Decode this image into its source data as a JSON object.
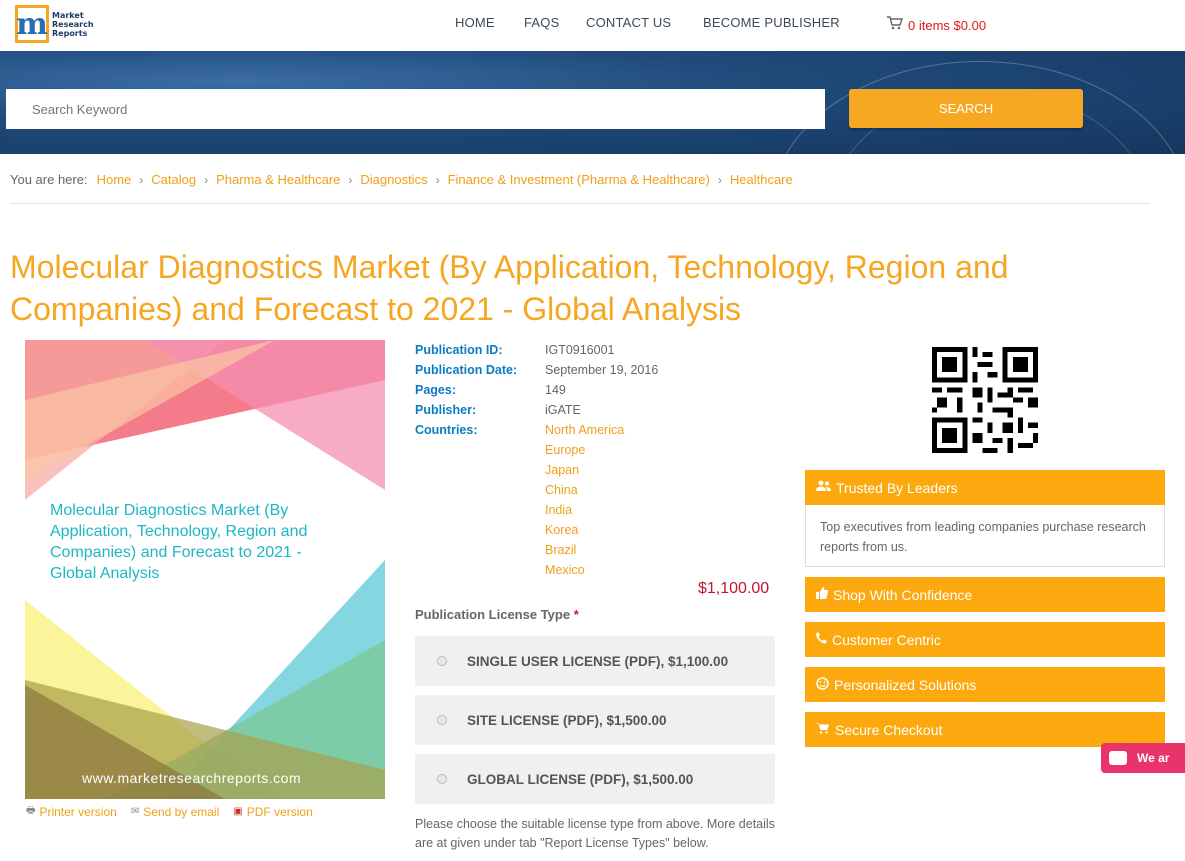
{
  "header": {
    "logo": {
      "line1": "Market",
      "line2": "Research",
      "line3": "Reports"
    },
    "nav": [
      {
        "label": "HOME"
      },
      {
        "label": "FAQS"
      },
      {
        "label": "CONTACT US"
      },
      {
        "label": "BECOME PUBLISHER"
      }
    ],
    "cart": {
      "label": "0 items $0.00"
    }
  },
  "search": {
    "placeholder": "Search Keyword",
    "button": "SEARCH"
  },
  "breadcrumb": {
    "prefix": "You are here:",
    "items": [
      "Home",
      "Catalog",
      "Pharma & Healthcare",
      "Diagnostics",
      "Finance & Investment (Pharma & Healthcare)",
      "Healthcare"
    ]
  },
  "report": {
    "title": "Molecular Diagnostics Market (By Application, Technology, Region and Companies) and Forecast to 2021 - Global Analysis",
    "cover_title": "Molecular Diagnostics Market (By Application, Technology, Region and Companies) and Forecast to 2021 - Global Analysis",
    "cover_url": "www.marketresearchreports.com",
    "links": [
      "Printer version",
      "Send by email",
      "PDF version"
    ],
    "meta": {
      "publication_id_label": "Publication ID:",
      "publication_id": "IGT0916001",
      "publication_date_label": "Publication Date:",
      "publication_date": "September 19, 2016",
      "pages_label": "Pages:",
      "pages": "149",
      "publisher_label": "Publisher:",
      "publisher": "iGATE",
      "countries_label": "Countries:",
      "countries": [
        "North America",
        "Europe",
        "Japan",
        "China",
        "India",
        "Korea",
        "Brazil",
        "Mexico"
      ]
    },
    "price": "$1,100.00",
    "license_label": "Publication License Type",
    "license_required": "*",
    "licenses": [
      "SINGLE USER LICENSE (PDF), $1,100.00",
      "SITE LICENSE (PDF), $1,500.00",
      "GLOBAL LICENSE (PDF), $1,500.00"
    ],
    "license_note": "Please choose the suitable license type from above. More details are at given under tab \"Report License Types\" below."
  },
  "sidebar": {
    "panels": [
      {
        "label": "Trusted By Leaders",
        "icon": "users-icon"
      },
      {
        "label": "Shop With Confidence",
        "icon": "thumbs-up-icon"
      },
      {
        "label": "Customer Centric",
        "icon": "phone-icon"
      },
      {
        "label": "Personalized Solutions",
        "icon": "smile-icon"
      },
      {
        "label": "Secure Checkout",
        "icon": "cart-icon"
      }
    ],
    "trusted_body": "Top executives from leading companies purchase research reports from us."
  },
  "chat": {
    "label": "We ar"
  },
  "colors": {
    "accent": "#f5a623",
    "link_blue": "#0b7cc4",
    "price_red": "#c0152f",
    "banner": "#1f4a7a"
  }
}
